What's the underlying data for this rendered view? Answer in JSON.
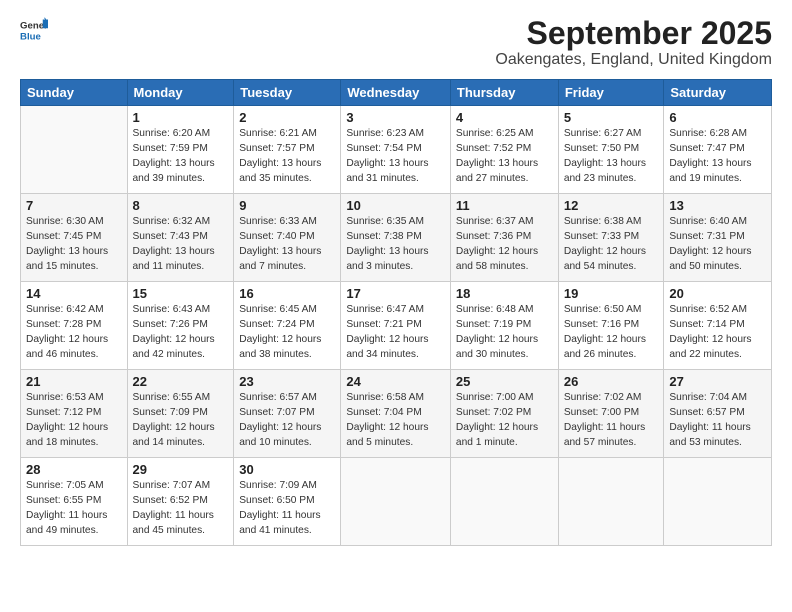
{
  "header": {
    "logo": {
      "general": "General",
      "blue": "Blue"
    },
    "title": "September 2025",
    "location": "Oakengates, England, United Kingdom"
  },
  "weekdays": [
    "Sunday",
    "Monday",
    "Tuesday",
    "Wednesday",
    "Thursday",
    "Friday",
    "Saturday"
  ],
  "weeks": [
    [
      {
        "day": null
      },
      {
        "day": 1,
        "sunrise": "Sunrise: 6:20 AM",
        "sunset": "Sunset: 7:59 PM",
        "daylight": "Daylight: 13 hours and 39 minutes."
      },
      {
        "day": 2,
        "sunrise": "Sunrise: 6:21 AM",
        "sunset": "Sunset: 7:57 PM",
        "daylight": "Daylight: 13 hours and 35 minutes."
      },
      {
        "day": 3,
        "sunrise": "Sunrise: 6:23 AM",
        "sunset": "Sunset: 7:54 PM",
        "daylight": "Daylight: 13 hours and 31 minutes."
      },
      {
        "day": 4,
        "sunrise": "Sunrise: 6:25 AM",
        "sunset": "Sunset: 7:52 PM",
        "daylight": "Daylight: 13 hours and 27 minutes."
      },
      {
        "day": 5,
        "sunrise": "Sunrise: 6:27 AM",
        "sunset": "Sunset: 7:50 PM",
        "daylight": "Daylight: 13 hours and 23 minutes."
      },
      {
        "day": 6,
        "sunrise": "Sunrise: 6:28 AM",
        "sunset": "Sunset: 7:47 PM",
        "daylight": "Daylight: 13 hours and 19 minutes."
      }
    ],
    [
      {
        "day": 7,
        "sunrise": "Sunrise: 6:30 AM",
        "sunset": "Sunset: 7:45 PM",
        "daylight": "Daylight: 13 hours and 15 minutes."
      },
      {
        "day": 8,
        "sunrise": "Sunrise: 6:32 AM",
        "sunset": "Sunset: 7:43 PM",
        "daylight": "Daylight: 13 hours and 11 minutes."
      },
      {
        "day": 9,
        "sunrise": "Sunrise: 6:33 AM",
        "sunset": "Sunset: 7:40 PM",
        "daylight": "Daylight: 13 hours and 7 minutes."
      },
      {
        "day": 10,
        "sunrise": "Sunrise: 6:35 AM",
        "sunset": "Sunset: 7:38 PM",
        "daylight": "Daylight: 13 hours and 3 minutes."
      },
      {
        "day": 11,
        "sunrise": "Sunrise: 6:37 AM",
        "sunset": "Sunset: 7:36 PM",
        "daylight": "Daylight: 12 hours and 58 minutes."
      },
      {
        "day": 12,
        "sunrise": "Sunrise: 6:38 AM",
        "sunset": "Sunset: 7:33 PM",
        "daylight": "Daylight: 12 hours and 54 minutes."
      },
      {
        "day": 13,
        "sunrise": "Sunrise: 6:40 AM",
        "sunset": "Sunset: 7:31 PM",
        "daylight": "Daylight: 12 hours and 50 minutes."
      }
    ],
    [
      {
        "day": 14,
        "sunrise": "Sunrise: 6:42 AM",
        "sunset": "Sunset: 7:28 PM",
        "daylight": "Daylight: 12 hours and 46 minutes."
      },
      {
        "day": 15,
        "sunrise": "Sunrise: 6:43 AM",
        "sunset": "Sunset: 7:26 PM",
        "daylight": "Daylight: 12 hours and 42 minutes."
      },
      {
        "day": 16,
        "sunrise": "Sunrise: 6:45 AM",
        "sunset": "Sunset: 7:24 PM",
        "daylight": "Daylight: 12 hours and 38 minutes."
      },
      {
        "day": 17,
        "sunrise": "Sunrise: 6:47 AM",
        "sunset": "Sunset: 7:21 PM",
        "daylight": "Daylight: 12 hours and 34 minutes."
      },
      {
        "day": 18,
        "sunrise": "Sunrise: 6:48 AM",
        "sunset": "Sunset: 7:19 PM",
        "daylight": "Daylight: 12 hours and 30 minutes."
      },
      {
        "day": 19,
        "sunrise": "Sunrise: 6:50 AM",
        "sunset": "Sunset: 7:16 PM",
        "daylight": "Daylight: 12 hours and 26 minutes."
      },
      {
        "day": 20,
        "sunrise": "Sunrise: 6:52 AM",
        "sunset": "Sunset: 7:14 PM",
        "daylight": "Daylight: 12 hours and 22 minutes."
      }
    ],
    [
      {
        "day": 21,
        "sunrise": "Sunrise: 6:53 AM",
        "sunset": "Sunset: 7:12 PM",
        "daylight": "Daylight: 12 hours and 18 minutes."
      },
      {
        "day": 22,
        "sunrise": "Sunrise: 6:55 AM",
        "sunset": "Sunset: 7:09 PM",
        "daylight": "Daylight: 12 hours and 14 minutes."
      },
      {
        "day": 23,
        "sunrise": "Sunrise: 6:57 AM",
        "sunset": "Sunset: 7:07 PM",
        "daylight": "Daylight: 12 hours and 10 minutes."
      },
      {
        "day": 24,
        "sunrise": "Sunrise: 6:58 AM",
        "sunset": "Sunset: 7:04 PM",
        "daylight": "Daylight: 12 hours and 5 minutes."
      },
      {
        "day": 25,
        "sunrise": "Sunrise: 7:00 AM",
        "sunset": "Sunset: 7:02 PM",
        "daylight": "Daylight: 12 hours and 1 minute."
      },
      {
        "day": 26,
        "sunrise": "Sunrise: 7:02 AM",
        "sunset": "Sunset: 7:00 PM",
        "daylight": "Daylight: 11 hours and 57 minutes."
      },
      {
        "day": 27,
        "sunrise": "Sunrise: 7:04 AM",
        "sunset": "Sunset: 6:57 PM",
        "daylight": "Daylight: 11 hours and 53 minutes."
      }
    ],
    [
      {
        "day": 28,
        "sunrise": "Sunrise: 7:05 AM",
        "sunset": "Sunset: 6:55 PM",
        "daylight": "Daylight: 11 hours and 49 minutes."
      },
      {
        "day": 29,
        "sunrise": "Sunrise: 7:07 AM",
        "sunset": "Sunset: 6:52 PM",
        "daylight": "Daylight: 11 hours and 45 minutes."
      },
      {
        "day": 30,
        "sunrise": "Sunrise: 7:09 AM",
        "sunset": "Sunset: 6:50 PM",
        "daylight": "Daylight: 11 hours and 41 minutes."
      },
      {
        "day": null
      },
      {
        "day": null
      },
      {
        "day": null
      },
      {
        "day": null
      }
    ]
  ]
}
